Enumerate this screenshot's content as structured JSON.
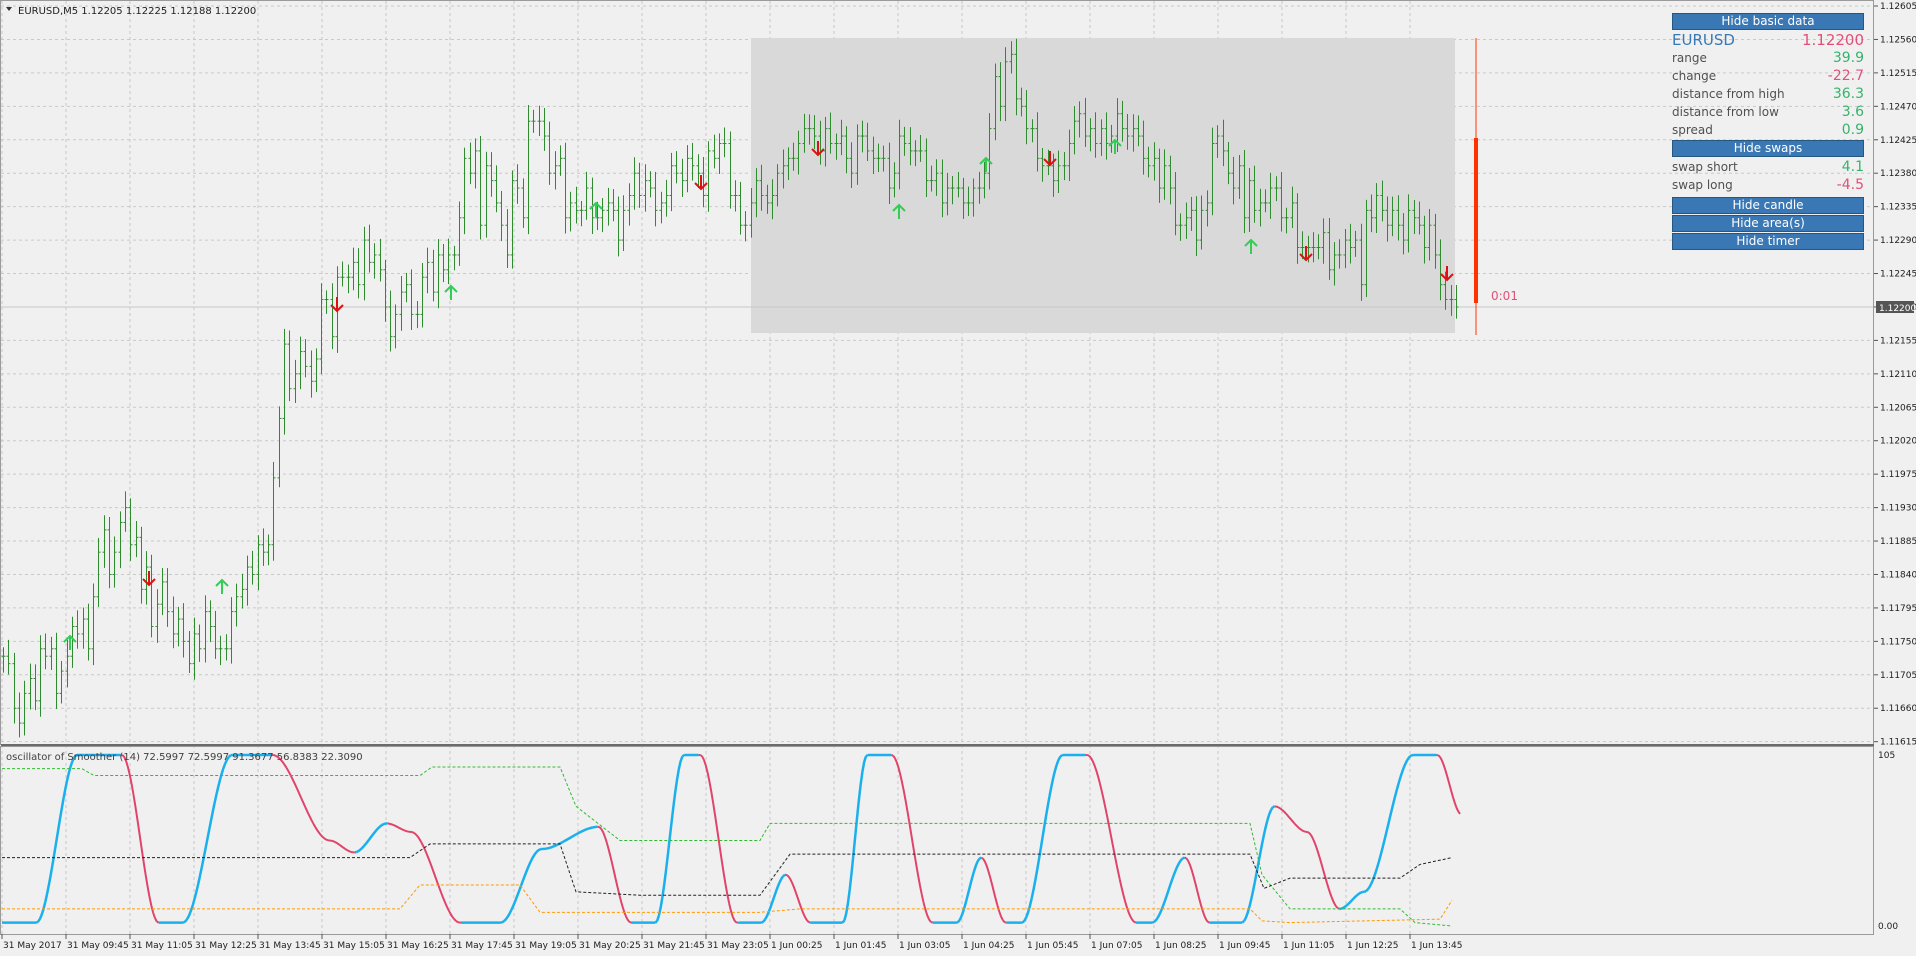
{
  "main_chart": {
    "header": "EURUSD,M5  1.12205 1.12225 1.12188 1.12200",
    "symbol_timeframe": "EURUSD,M5",
    "ohlc": "1.12205 1.12225 1.12188 1.12200",
    "current_price_label": "1.12200",
    "timer_label": "0:01",
    "price_axis": [
      "1.12605",
      "1.12560",
      "1.12515",
      "1.12470",
      "1.12425",
      "1.12380",
      "1.12335",
      "1.12290",
      "1.12245",
      "1.12200",
      "1.12155",
      "1.12110",
      "1.12065",
      "1.12020",
      "1.11975",
      "1.11930",
      "1.11885",
      "1.11840",
      "1.11795",
      "1.11750",
      "1.11705",
      "1.11660",
      "1.11615"
    ],
    "time_axis": [
      "31 May 2017",
      "31 May 09:45",
      "31 May 11:05",
      "31 May 12:25",
      "31 May 13:45",
      "31 May 15:05",
      "31 May 16:25",
      "31 May 17:45",
      "31 May 19:05",
      "31 May 20:25",
      "31 May 21:45",
      "31 May 23:05",
      "1 Jun 00:25",
      "1 Jun 01:45",
      "1 Jun 03:05",
      "1 Jun 04:25",
      "1 Jun 05:45",
      "1 Jun 07:05",
      "1 Jun 08:25",
      "1 Jun 09:45",
      "1 Jun 11:05",
      "1 Jun 12:25",
      "1 Jun 13:45"
    ],
    "colors": {
      "bars": "#2e8b2e",
      "arrow_up": "#33cc55",
      "arrow_down": "#dd1111",
      "area": "#d9d9d9",
      "timer_bar": "#ff3300",
      "timer_text": "#e0507a"
    }
  },
  "chart_data": {
    "type": "bar",
    "title": "EURUSD,M5",
    "price_range": [
      1.11615,
      1.12605
    ],
    "close": [
      1.1173,
      1.1172,
      1.1166,
      1.1164,
      1.1168,
      1.117,
      1.1167,
      1.1174,
      1.1173,
      1.1174,
      1.1168,
      1.1171,
      1.1173,
      1.1177,
      1.1176,
      1.1178,
      1.1174,
      1.1181,
      1.1187,
      1.119,
      1.1184,
      1.1187,
      1.1191,
      1.1193,
      1.1188,
      1.1189,
      1.1182,
      1.1185,
      1.1177,
      1.118,
      1.1183,
      1.1179,
      1.1176,
      1.1178,
      1.1175,
      1.1172,
      1.1176,
      1.1174,
      1.1179,
      1.1177,
      1.1174,
      1.1174,
      1.1174,
      1.1179,
      1.1181,
      1.1182,
      1.1185,
      1.1184,
      1.1188,
      1.1187,
      1.1188,
      1.1197,
      1.1205,
      1.1215,
      1.1209,
      1.1211,
      1.1214,
      1.1212,
      1.121,
      1.1213,
      1.1221,
      1.1221,
      1.1216,
      1.1224,
      1.1224,
      1.1224,
      1.1226,
      1.1223,
      1.1229,
      1.1226,
      1.1227,
      1.1225,
      1.122,
      1.1216,
      1.1219,
      1.1222,
      1.1223,
      1.1219,
      1.1219,
      1.1224,
      1.1226,
      1.1222,
      1.1227,
      1.1225,
      1.1227,
      1.1227,
      1.1232,
      1.124,
      1.1238,
      1.1241,
      1.1231,
      1.1239,
      1.1237,
      1.1234,
      1.1231,
      1.1227,
      1.1237,
      1.1236,
      1.1232,
      1.1245,
      1.1245,
      1.1245,
      1.1243,
      1.1238,
      1.1239,
      1.124,
      1.1232,
      1.1234,
      1.1233,
      1.1233,
      1.1236,
      1.1232,
      1.1232,
      1.1233,
      1.1234,
      1.1233,
      1.1229,
      1.1233,
      1.1235,
      1.1238,
      1.1235,
      1.1237,
      1.1236,
      1.1233,
      1.1234,
      1.1235,
      1.1239,
      1.1238,
      1.1237,
      1.124,
      1.1239,
      1.1238,
      1.1235,
      1.1241,
      1.124,
      1.1242,
      1.1242,
      1.1235,
      1.1235,
      1.1231,
      1.1231,
      1.1234,
      1.1237,
      1.1235,
      1.1234,
      1.1235,
      1.1238,
      1.1239,
      1.124,
      1.124,
      1.1242,
      1.1244,
      1.1244,
      1.1243,
      1.1241,
      1.1244,
      1.1242,
      1.1242,
      1.1243,
      1.124,
      1.1238,
      1.1243,
      1.1243,
      1.1241,
      1.124,
      1.124,
      1.124,
      1.1236,
      1.1238,
      1.1243,
      1.1242,
      1.1241,
      1.1241,
      1.1241,
      1.1237,
      1.1237,
      1.1238,
      1.1234,
      1.1236,
      1.1236,
      1.1236,
      1.1234,
      1.1234,
      1.1236,
      1.1236,
      1.1238,
      1.1244,
      1.1251,
      1.1247,
      1.1253,
      1.1254,
      1.1248,
      1.1247,
      1.1244,
      1.1244,
      1.124,
      1.1239,
      1.1239,
      1.1237,
      1.1239,
      1.1239,
      1.1242,
      1.1245,
      1.1246,
      1.1243,
      1.1244,
      1.1242,
      1.1244,
      1.1242,
      1.1243,
      1.1246,
      1.1244,
      1.1243,
      1.1244,
      1.1243,
      1.124,
      1.1239,
      1.124,
      1.1236,
      1.1239,
      1.1236,
      1.1231,
      1.1231,
      1.1232,
      1.1233,
      1.1229,
      1.1233,
      1.1234,
      1.1242,
      1.1243,
      1.1241,
      1.1238,
      1.1236,
      1.1239,
      1.1232,
      1.1237,
      1.1233,
      1.1234,
      1.1234,
      1.1236,
      1.1236,
      1.1232,
      1.1232,
      1.1234,
      1.1228,
      1.1228,
      1.1228,
      1.1228,
      1.1228,
      1.123,
      1.1225,
      1.1227,
      1.1227,
      1.1229,
      1.1228,
      1.1229,
      1.1223,
      1.1233,
      1.1232,
      1.1235,
      1.1233,
      1.1231,
      1.1233,
      1.1231,
      1.1229,
      1.1233,
      1.1232,
      1.1231,
      1.1228,
      1.1231,
      1.1227,
      1.1223,
      1.1221,
      1.1221,
      1.122
    ]
  },
  "info_panel": {
    "hide_basic_data": "Hide basic data",
    "symbol": "EURUSD",
    "price": "1.12200",
    "rows": [
      {
        "label": "range",
        "value": "39.9",
        "color": "#36b36b"
      },
      {
        "label": "change",
        "value": "-22.7",
        "color": "#e0507a"
      },
      {
        "label": "distance from high",
        "value": "36.3",
        "color": "#36b36b"
      },
      {
        "label": "distance from low",
        "value": "3.6",
        "color": "#36b36b"
      },
      {
        "label": "spread",
        "value": "0.9",
        "color": "#36b36b"
      }
    ],
    "hide_swaps": "Hide swaps",
    "swap_rows": [
      {
        "label": "swap short",
        "value": "4.1",
        "color": "#36b36b"
      },
      {
        "label": "swap long",
        "value": "-4.5",
        "color": "#e0507a"
      }
    ],
    "hide_candle": "Hide candle",
    "hide_areas": "Hide area(s)",
    "hide_timer": "Hide timer"
  },
  "oscillator": {
    "label": "oscillator of Smoother (14) 72.5997 72.5997 91.3677 56.8383 22.3090",
    "axis_top": "105",
    "axis_bottom": "0.00",
    "colors": {
      "up": "#1ab0ee",
      "down": "#e0446a",
      "level_high": "#33bb33",
      "level_mid": "#222222",
      "level_low": "#ff9900"
    }
  }
}
